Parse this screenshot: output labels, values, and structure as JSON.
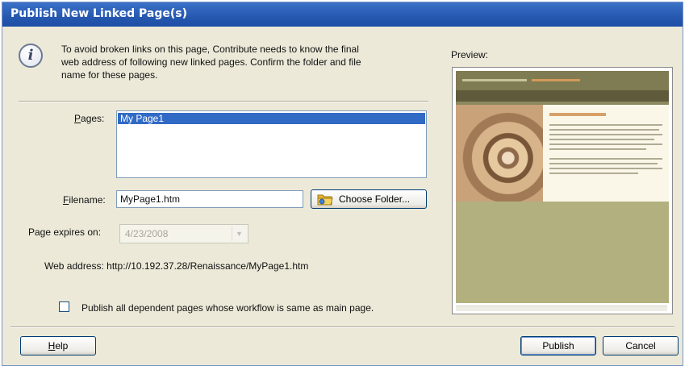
{
  "dialog": {
    "title": "Publish New Linked Page(s)",
    "info_line1": "To avoid broken links on this page, Contribute needs to know the final",
    "info_line2": "web address of following new linked pages. Confirm the folder and file",
    "info_line3": "name for these pages."
  },
  "pages": {
    "label_key": "P",
    "label_rest": "ages:",
    "items": [
      "My Page1"
    ]
  },
  "filename": {
    "label_key": "F",
    "label_rest": "ilename:",
    "value": "MyPage1.htm",
    "choose_folder_label": "Choose Folder..."
  },
  "expires": {
    "label": "Page expires on:",
    "value": "4/23/2008"
  },
  "web_address": {
    "label": "Web address:",
    "value": "http://10.192.37.28/Renaissance/MyPage1.htm"
  },
  "dependent": {
    "label": "Publish all dependent pages whose workflow is same as main page.",
    "checked": false
  },
  "preview": {
    "label": "Preview:"
  },
  "buttons": {
    "help_key": "H",
    "help_rest": "elp",
    "publish": "Publish",
    "cancel": "Cancel"
  },
  "colors": {
    "titlebar": "#2658b0",
    "selection": "#316ac5",
    "preview_olive": "#b3b080"
  },
  "icons": [
    "info-icon",
    "folder-icon",
    "chevron-down-icon"
  ]
}
